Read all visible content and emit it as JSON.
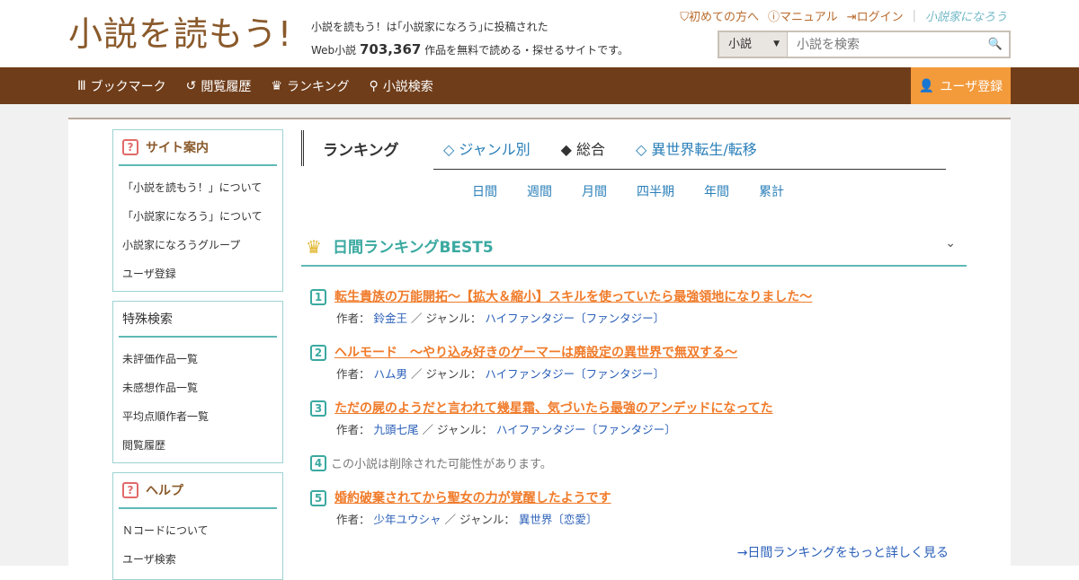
{
  "header": {
    "logo": "小説を読もう!",
    "tagline_line1": "小説を読もう！は｢小説家になろう｣に投稿された",
    "tagline_prefix": "Web小説",
    "work_count": "703,367",
    "tagline_suffix": "作品を無料で読める・探せるサイトです。",
    "links": [
      "初めての方へ",
      "マニュアル",
      "ログイン"
    ],
    "narou_logo": "小説家になろう",
    "search": {
      "select_value": "小説",
      "placeholder": "小説を検索"
    }
  },
  "nav": {
    "items": [
      "ブックマーク",
      "閲覧履歴",
      "ランキング",
      "小説検索"
    ],
    "register": "ユーザ登録"
  },
  "sidebar": {
    "site_guide": {
      "title": "サイト案内",
      "items": [
        "「小説を読もう！」について",
        "「小説家になろう」について",
        "小説家になろうグループ",
        "ユーザ登録"
      ]
    },
    "special_search": {
      "title": "特殊検索",
      "items": [
        "未評価作品一覧",
        "未感想作品一覧",
        "平均点順作者一覧",
        "閲覧履歴"
      ]
    },
    "help": {
      "title": "ヘルプ",
      "items": [
        "Ｎコードについて",
        "ユーザ検索"
      ]
    }
  },
  "ranking": {
    "title": "ランキング",
    "tabs": [
      "◇ ジャンル別",
      "◆ 総合",
      "◇ 異世界転生/転移"
    ],
    "active_tab": 1,
    "periods": [
      "日間",
      "週間",
      "月間",
      "四半期",
      "年間",
      "累計"
    ],
    "best_title": "日間ランキングBEST5",
    "author_label": "作者：",
    "genre_label": "ジャンル：",
    "entries": [
      {
        "rank": "1",
        "title": "転生貴族の万能開拓～【拡大＆縮小】スキルを使っていたら最強領地になりました～",
        "author": "鈴金王",
        "genre": "ハイファンタジー〔ファンタジー〕"
      },
      {
        "rank": "2",
        "title": "ヘルモード　～やり込み好きのゲーマーは廃設定の異世界で無双する～",
        "author": "ハム男",
        "genre": "ハイファンタジー〔ファンタジー〕"
      },
      {
        "rank": "3",
        "title": "ただの屍のようだと言われて幾星霜、気づいたら最強のアンデッドになってた",
        "author": "九頭七尾",
        "genre": "ハイファンタジー〔ファンタジー〕"
      },
      {
        "rank": "4",
        "deleted": "この小説は削除された可能性があります。"
      },
      {
        "rank": "5",
        "title": "婚約破棄されてから聖女の力が覚醒したようです",
        "author": "少年ユウシャ",
        "genre": "異世界〔恋愛〕"
      }
    ],
    "more_link": "→日間ランキングをもっと詳しく見る"
  }
}
